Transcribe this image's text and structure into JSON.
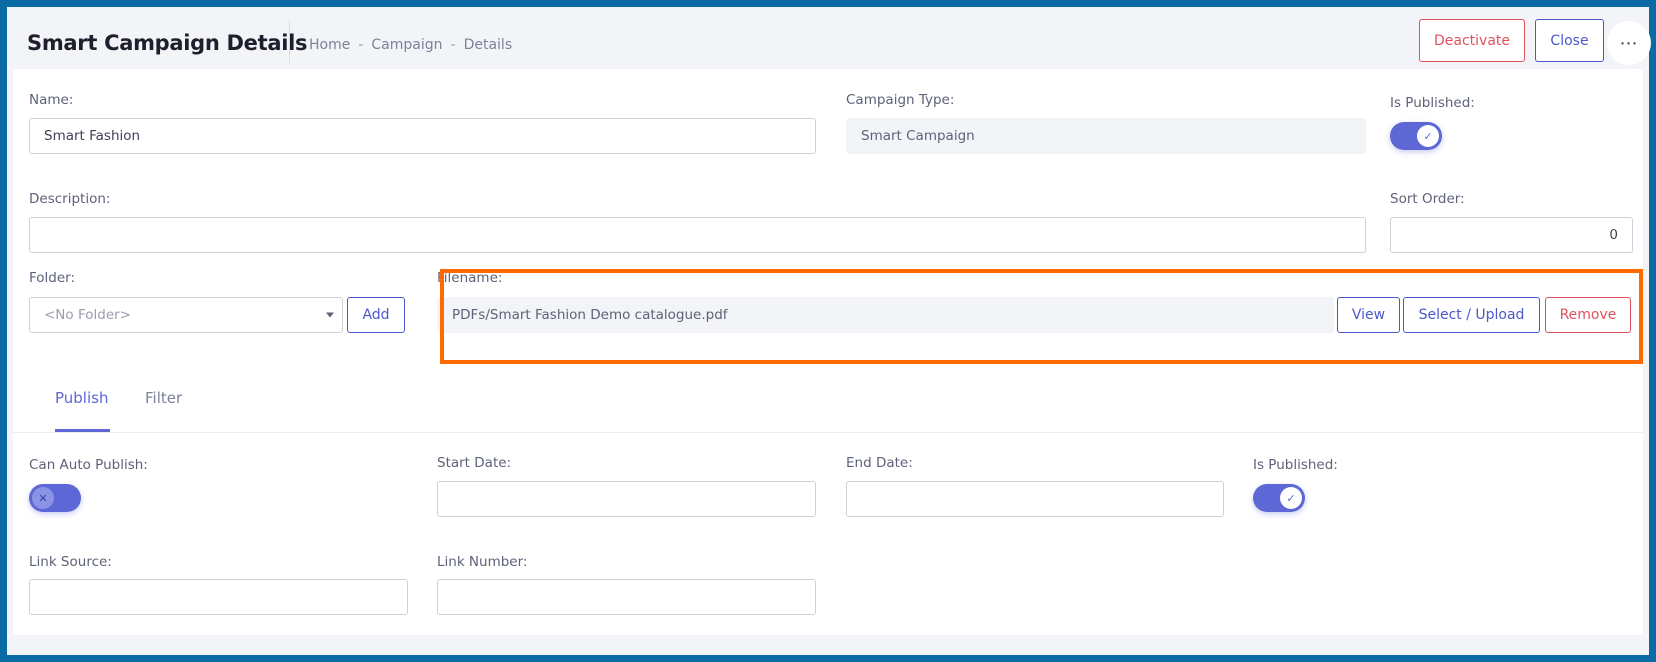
{
  "header": {
    "title": "Smart Campaign Details",
    "breadcrumb": [
      "Home",
      "Campaign",
      "Details"
    ],
    "deactivate_label": "Deactivate",
    "close_label": "Close",
    "more_label": "⋯"
  },
  "form": {
    "name_label": "Name:",
    "name_value": "Smart Fashion",
    "campaign_type_label": "Campaign Type:",
    "campaign_type_value": "Smart Campaign",
    "is_published_label": "Is Published:",
    "is_published": true,
    "description_label": "Description:",
    "description_value": "",
    "sort_order_label": "Sort Order:",
    "sort_order_value": "0",
    "folder_label": "Folder:",
    "folder_value": "<No Folder>",
    "add_label": "Add",
    "filename_label": "Filename:",
    "filename_value": "PDFs/Smart Fashion Demo catalogue.pdf",
    "view_label": "View",
    "select_upload_label": "Select / Upload",
    "remove_label": "Remove"
  },
  "tabs": [
    {
      "label": "Publish",
      "active": true
    },
    {
      "label": "Filter",
      "active": false
    }
  ],
  "publish": {
    "can_auto_publish_label": "Can Auto Publish:",
    "can_auto_publish": false,
    "start_date_label": "Start Date:",
    "start_date_value": "",
    "end_date_label": "End Date:",
    "end_date_value": "",
    "is_published_label": "Is Published:",
    "is_published": true,
    "link_source_label": "Link Source:",
    "link_source_value": "",
    "link_number_label": "Link Number:",
    "link_number_value": ""
  },
  "colors": {
    "accent": "#5e67d6",
    "danger": "#e0525e",
    "highlight": "#ff6a00",
    "frame": "#0a6aa3"
  },
  "icons": {
    "check": "check-icon",
    "x": "close-icon",
    "more": "more-horizontal-icon",
    "caret": "chevron-down-icon"
  }
}
